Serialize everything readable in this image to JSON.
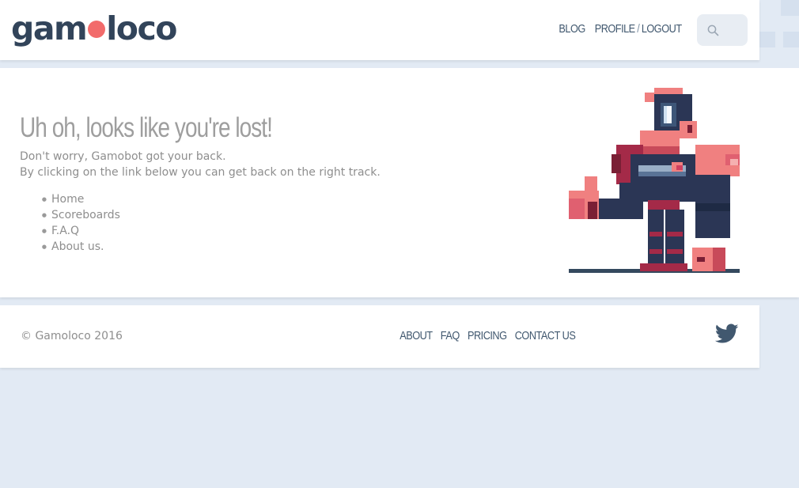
{
  "header": {
    "logo": {
      "left": "gam",
      "right": "loco"
    },
    "nav": {
      "blog": "BLOG",
      "profile": "PROFILE",
      "separator": "/",
      "logout": "LOGOUT"
    },
    "search": {
      "placeholder": ""
    }
  },
  "main": {
    "title": "Uh oh, looks like you're lost!",
    "line1": "Don't worry, Gamobot got your back.",
    "line2": "By clicking on the link below you can get back on the right track.",
    "links": [
      "Home",
      "Scoreboards",
      "F.A.Q",
      "About us."
    ]
  },
  "footer": {
    "copyright": "© Gamoloco 2016",
    "nav": [
      "ABOUT",
      "FAQ",
      "PRICING",
      "CONTACT US"
    ]
  },
  "colors": {
    "background": "#e2eaf4",
    "brand_dark": "#32445a",
    "brand_accent": "#f26b6b",
    "nav_text": "#41586f",
    "body_text": "#8e8e8e"
  },
  "icons": [
    "search-icon",
    "twitter-icon",
    "robot-mascot"
  ]
}
